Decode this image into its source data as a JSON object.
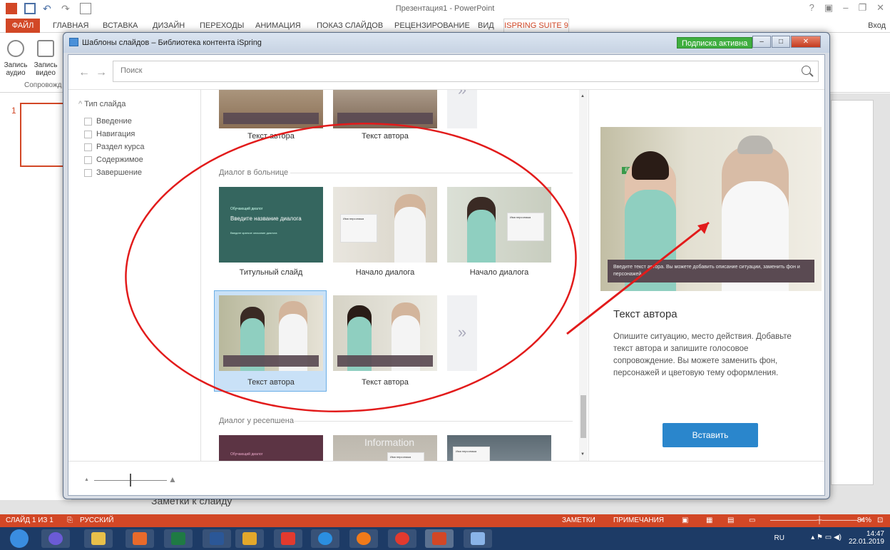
{
  "powerpoint": {
    "window_title": "Презентация1 - PowerPoint",
    "tabs": [
      "ФАЙЛ",
      "ГЛАВНАЯ",
      "ВСТАВКА",
      "ДИЗАЙН",
      "ПЕРЕХОДЫ",
      "АНИМАЦИЯ",
      "ПОКАЗ СЛАЙДОВ",
      "РЕЦЕНЗИРОВАНИЕ",
      "ВИД",
      "ISPRING SUITE 9"
    ],
    "sign_in": "Вход",
    "ribbon_buttons": [
      {
        "line1": "Запись",
        "line2": "аудио"
      },
      {
        "line1": "Запись",
        "line2": "видео"
      }
    ],
    "ribbon_group": "Сопровожд",
    "slide_number": "1",
    "notes_label": "Заметки к слайду",
    "statusbar": {
      "slide": "СЛАЙД 1 ИЗ 1",
      "language": "РУССКИЙ",
      "notes": "ЗАМЕТКИ",
      "comments": "ПРИМЕЧАНИЯ",
      "zoom": "84%"
    }
  },
  "dialog": {
    "title": "Шаблоны слайдов – Библиотека контента iSpring",
    "subscription": "Подписка активна",
    "search_placeholder": "Поиск",
    "filter": {
      "header": "Тип слайда",
      "items": [
        "Введение",
        "Навигация",
        "Раздел курса",
        "Содержимое",
        "Завершение"
      ]
    },
    "gallery": {
      "top_row": [
        "Текст автора",
        "Текст автора"
      ],
      "section_hospital": "Диалог в больнице",
      "hospital_row1": [
        "Титульный слайд",
        "Начало диалога",
        "Начало диалога"
      ],
      "hospital_row2": [
        "Текст автора",
        "Текст автора"
      ],
      "section_reception": "Диалог у ресепшена",
      "title_slide_small": "Обучающий диалог",
      "title_slide_big": "Введите название диалога",
      "title_slide_sub": "Введите краткое описание диалога",
      "info_card_title": "Имя персонажа",
      "reception_sign": "Information"
    },
    "preview": {
      "caption": "Введите текст автора. Вы можете добавить описание ситуации, заменить фон и персонажей",
      "title": "Текст автора",
      "description": "Опишите ситуацию, место действия. Добавьте текст автора и запишите голосовое сопровождение. Вы можете заменить фон, персонажей и цветовую тему оформления.",
      "exit_sign": "EXIT"
    },
    "insert_button": "Вставить"
  },
  "taskbar": {
    "lang": "RU",
    "time": "14:47",
    "date": "22.01.2019"
  }
}
